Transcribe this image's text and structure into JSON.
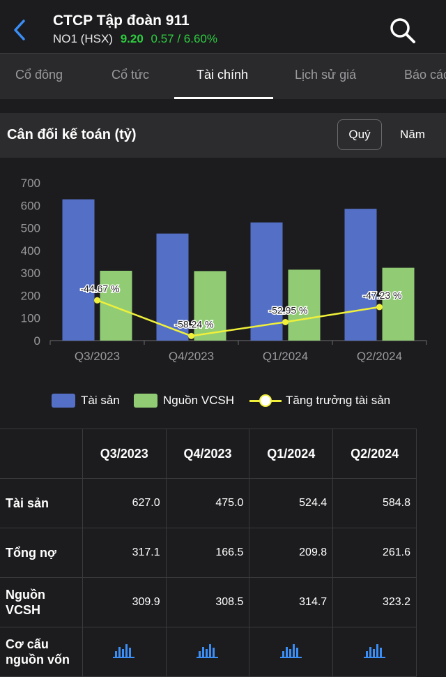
{
  "header": {
    "title": "CTCP Tập đoàn 911",
    "code": "NO1 (HSX)",
    "price": "9.20",
    "change": "0.57 / 6.60%"
  },
  "tabs": [
    {
      "label": "Cổ đông"
    },
    {
      "label": "Cổ tức"
    },
    {
      "label": "Tài chính"
    },
    {
      "label": "Lịch sử giá"
    },
    {
      "label": "Báo các"
    }
  ],
  "section": {
    "title": "Cân đối kế toán (tỷ)",
    "period_quarter": "Quý",
    "period_year": "Năm"
  },
  "colors": {
    "assets": "#5470c6",
    "equity": "#91cc75",
    "growth": "#f0f03a",
    "positive": "#2ecc40"
  },
  "chart_data": {
    "type": "bar",
    "categories": [
      "Q3/2023",
      "Q4/2023",
      "Q1/2024",
      "Q2/2024"
    ],
    "series": [
      {
        "name": "Tài sản",
        "type": "bar",
        "values": [
          627.0,
          475.0,
          524.4,
          584.8
        ]
      },
      {
        "name": "Nguồn VCSH",
        "type": "bar",
        "values": [
          309.9,
          308.5,
          314.7,
          323.2
        ]
      },
      {
        "name": "Tăng trưởng tài sản",
        "type": "line",
        "values": [
          -44.67,
          -58.24,
          -52.95,
          -47.23
        ],
        "labels": [
          "-44.67 %",
          "-58.24 %",
          "-52.95 %",
          "-47.23 %"
        ]
      }
    ],
    "yticks": [
      "0",
      "100",
      "200",
      "300",
      "400",
      "500",
      "600",
      "700"
    ],
    "ylim": [
      0,
      700
    ],
    "growth_axis_range": [
      -60,
      0
    ],
    "legend": "bottom"
  },
  "table": {
    "headers": [
      "Q3/2023",
      "Q4/2023",
      "Q1/2024",
      "Q2/2024"
    ],
    "rows": [
      {
        "label": "Tài sản",
        "values": [
          "627.0",
          "475.0",
          "524.4",
          "584.8"
        ]
      },
      {
        "label": "Tổng nợ",
        "values": [
          "317.1",
          "166.5",
          "209.8",
          "261.6"
        ]
      },
      {
        "label": "Nguồn VCSH",
        "values": [
          "309.9",
          "308.5",
          "314.7",
          "323.2"
        ]
      }
    ],
    "structure_row_label": "Cơ cấu nguồn vốn",
    "structure_icon": "bar-chart-icon"
  }
}
